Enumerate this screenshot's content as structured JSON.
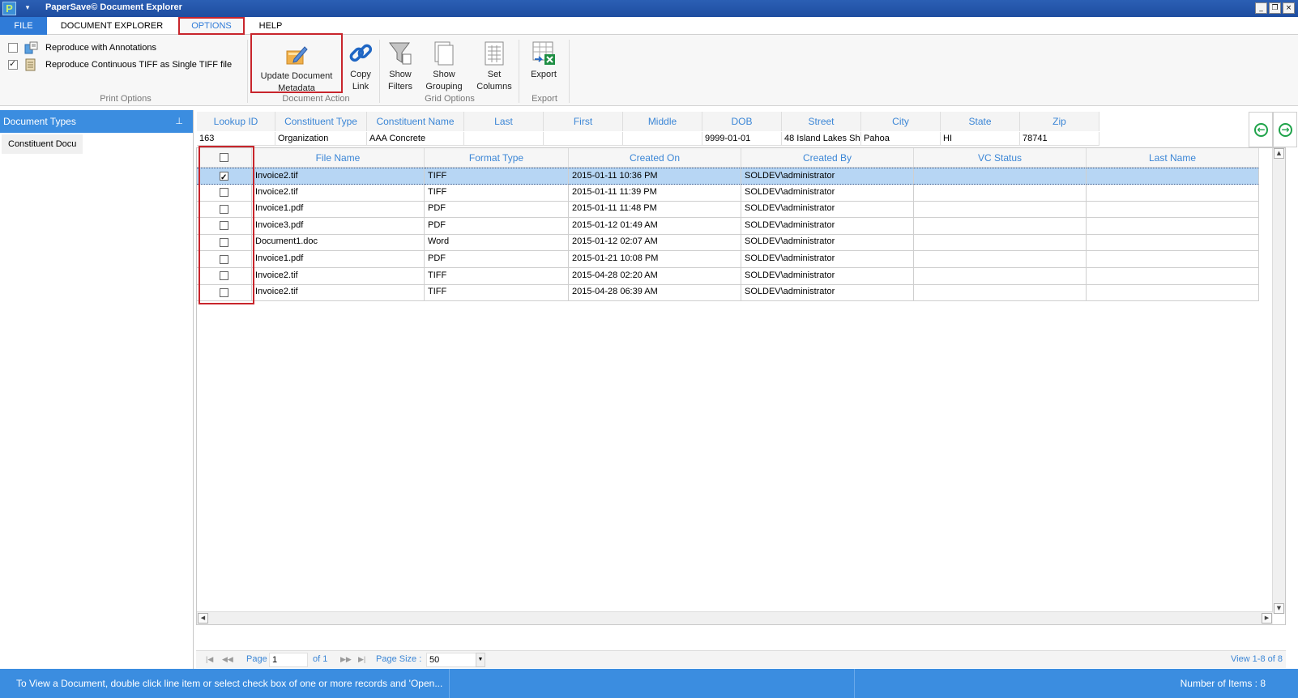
{
  "window": {
    "title": "PaperSave© Document Explorer",
    "app_icon_letter": "P",
    "quick_access": "▾",
    "minimize": "_",
    "restore": "❐",
    "close": "×"
  },
  "tabs": [
    {
      "label": "FILE"
    },
    {
      "label": "DOCUMENT EXPLORER"
    },
    {
      "label": "OPTIONS"
    },
    {
      "label": "HELP"
    }
  ],
  "ribbon": {
    "print_options": {
      "reproduce_annotations": {
        "label": "Reproduce with Annotations",
        "checked": false
      },
      "reproduce_tiff": {
        "label": "Reproduce Continuous TIFF as Single TIFF file",
        "checked": true
      },
      "group_label": "Print Options"
    },
    "document_action": {
      "update_metadata": {
        "line1": "Update Document",
        "line2": "Metadata"
      },
      "copy_link": {
        "line1": "Copy",
        "line2": "Link"
      },
      "group_label": "Document Action"
    },
    "grid_options": {
      "show_filters": {
        "line1": "Show",
        "line2": "Filters"
      },
      "show_grouping": {
        "line1": "Show",
        "line2": "Grouping"
      },
      "set_columns": {
        "line1": "Set",
        "line2": "Columns"
      },
      "group_label": "Grid Options"
    },
    "export": {
      "export_btn": {
        "line1": "Export"
      },
      "group_label": "Export"
    }
  },
  "left_panel": {
    "header": "Document Types",
    "pin": "⊥",
    "items": [
      {
        "label": "Constituent Docu"
      }
    ]
  },
  "lookup": {
    "headers": [
      "Lookup ID",
      "Constituent Type",
      "Constituent Name",
      "Last",
      "First",
      "Middle",
      "DOB",
      "Street",
      "City",
      "State",
      "Zip"
    ],
    "values": [
      "163",
      "Organization",
      "AAA Concrete",
      "",
      "",
      "",
      "9999-01-01",
      "48 Island Lakes Sh",
      "Pahoa",
      "HI",
      "78741"
    ]
  },
  "grid": {
    "headers": [
      "",
      "File Name",
      "Format Type",
      "Created On",
      "Created By",
      "VC Status",
      "Last Name"
    ],
    "rows": [
      {
        "checked": true,
        "selected": true,
        "file": "Invoice2.tif",
        "format": "TIFF",
        "created": "2015-01-11 10:36 PM",
        "by": "SOLDEV\\administrator",
        "vc": "",
        "last": ""
      },
      {
        "checked": false,
        "selected": false,
        "file": "Invoice2.tif",
        "format": "TIFF",
        "created": "2015-01-11 11:39 PM",
        "by": "SOLDEV\\administrator",
        "vc": "",
        "last": ""
      },
      {
        "checked": false,
        "selected": false,
        "file": "Invoice1.pdf",
        "format": "PDF",
        "created": "2015-01-11 11:48 PM",
        "by": "SOLDEV\\administrator",
        "vc": "",
        "last": ""
      },
      {
        "checked": false,
        "selected": false,
        "file": "Invoice3.pdf",
        "format": "PDF",
        "created": "2015-01-12 01:49 AM",
        "by": "SOLDEV\\administrator",
        "vc": "",
        "last": ""
      },
      {
        "checked": false,
        "selected": false,
        "file": "Document1.doc",
        "format": "Word",
        "created": "2015-01-12 02:07 AM",
        "by": "SOLDEV\\administrator",
        "vc": "",
        "last": ""
      },
      {
        "checked": false,
        "selected": false,
        "file": "Invoice1.pdf",
        "format": "PDF",
        "created": "2015-01-21 10:08 PM",
        "by": "SOLDEV\\administrator",
        "vc": "",
        "last": ""
      },
      {
        "checked": false,
        "selected": false,
        "file": "Invoice2.tif",
        "format": "TIFF",
        "created": "2015-04-28 02:20 AM",
        "by": "SOLDEV\\administrator",
        "vc": "",
        "last": ""
      },
      {
        "checked": false,
        "selected": false,
        "file": "Invoice2.tif",
        "format": "TIFF",
        "created": "2015-04-28 06:39 AM",
        "by": "SOLDEV\\administrator",
        "vc": "",
        "last": ""
      }
    ]
  },
  "pager": {
    "first": "|◀",
    "prev": "◀◀",
    "page_label": "Page",
    "page_value": "1",
    "of_label": "of 1",
    "next": "▶▶",
    "last": "▶|",
    "page_size_label": "Page Size :",
    "page_size_value": "50",
    "view_text": "View 1-8 of 8"
  },
  "status": {
    "message": "To View a Document, double click line item or select check box of one or more records and 'Open...",
    "item_count": "Number of Items : 8"
  },
  "colors": {
    "accent": "#3b8de0",
    "highlight_red": "#c8252c",
    "selected_row": "#b7d6f4"
  }
}
